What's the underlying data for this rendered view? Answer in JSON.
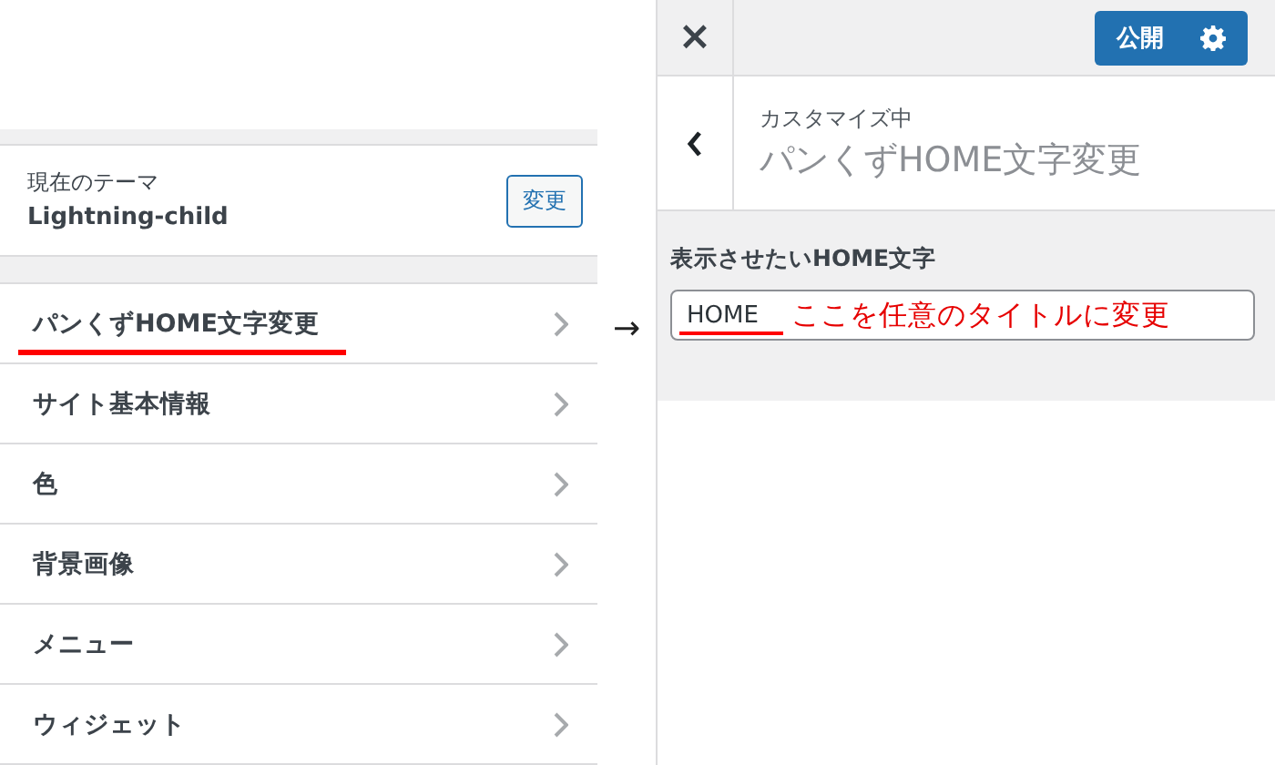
{
  "theme": {
    "label": "現在のテーマ",
    "name": "Lightning-child",
    "change_button": "変更"
  },
  "menu_items": [
    {
      "label": "パンくずHOME文字変更",
      "underlined": true
    },
    {
      "label": "サイト基本情報",
      "underlined": false
    },
    {
      "label": "色",
      "underlined": false
    },
    {
      "label": "背景画像",
      "underlined": false
    },
    {
      "label": "メニュー",
      "underlined": false
    },
    {
      "label": "ウィジェット",
      "underlined": false
    }
  ],
  "arrow": "→",
  "header": {
    "close": "×",
    "publish_button": "公開"
  },
  "section": {
    "subtitle": "カスタマイズ中",
    "title": "パンくずHOME文字変更"
  },
  "field": {
    "label": "表示させたいHOME文字",
    "value": "HOME",
    "underlined": true,
    "annotation": "ここを任意のタイトルに変更"
  }
}
